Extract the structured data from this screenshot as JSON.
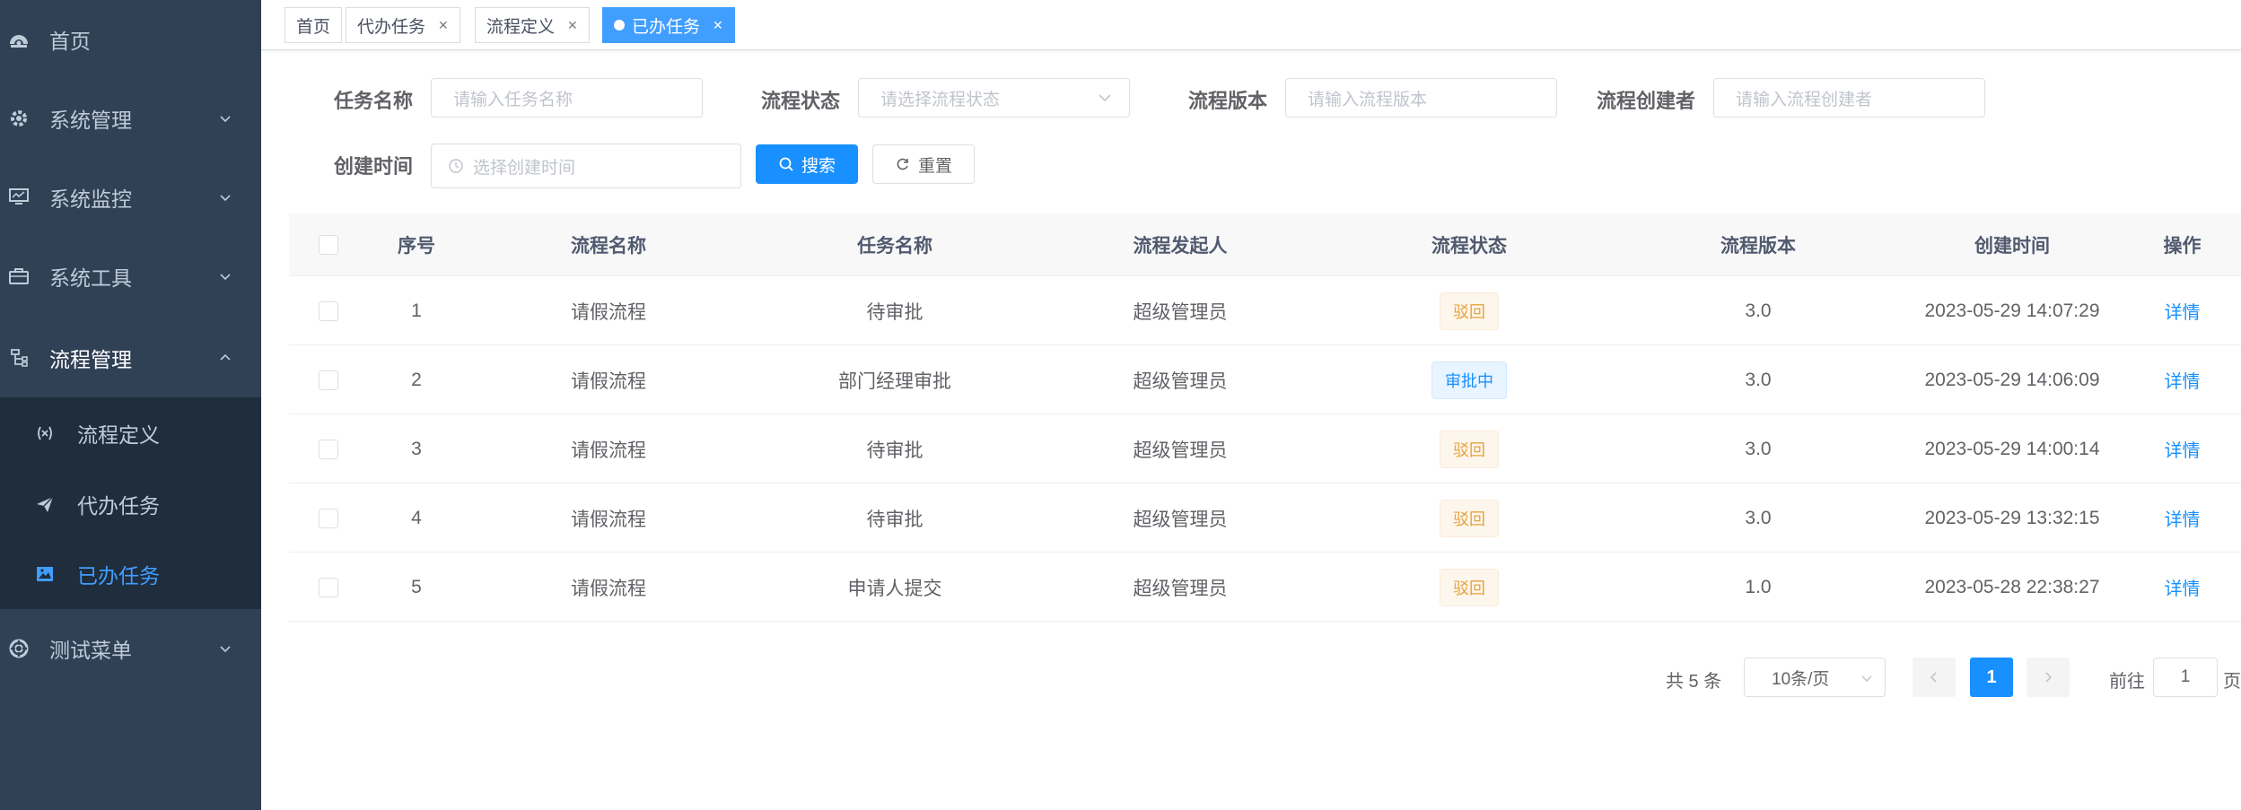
{
  "sidebar": {
    "items": [
      {
        "label": "首页",
        "icon": "dashboard-icon"
      },
      {
        "label": "系统管理",
        "icon": "gear-icon"
      },
      {
        "label": "系统监控",
        "icon": "monitor-icon"
      },
      {
        "label": "系统工具",
        "icon": "toolbox-icon"
      },
      {
        "label": "流程管理",
        "icon": "flow-icon"
      },
      {
        "label": "测试菜单",
        "icon": "test-icon"
      }
    ],
    "sub_items": [
      {
        "label": "流程定义",
        "icon": "process-definition-icon"
      },
      {
        "label": "代办任务",
        "icon": "send-icon"
      },
      {
        "label": "已办任务",
        "icon": "image-icon"
      }
    ]
  },
  "tags": [
    {
      "label": "首页"
    },
    {
      "label": "代办任务"
    },
    {
      "label": "流程定义"
    },
    {
      "label": "已办任务"
    }
  ],
  "search": {
    "task_name_label": "任务名称",
    "task_name_placeholder": "请输入任务名称",
    "status_label": "流程状态",
    "status_placeholder": "请选择流程状态",
    "version_label": "流程版本",
    "version_placeholder": "请输入流程版本",
    "creator_label": "流程创建者",
    "creator_placeholder": "请输入流程创建者",
    "time_label": "创建时间",
    "time_placeholder": "选择创建时间",
    "search_button": "搜索",
    "reset_button": "重置"
  },
  "table": {
    "columns": [
      "序号",
      "流程名称",
      "任务名称",
      "流程发起人",
      "流程状态",
      "流程版本",
      "创建时间",
      "操作"
    ],
    "rows": [
      {
        "index": "1",
        "process_name": "请假流程",
        "task_name": "待审批",
        "initiator": "超级管理员",
        "status": "驳回",
        "version": "3.0",
        "created": "2023-05-29 14:07:29",
        "action": "详情"
      },
      {
        "index": "2",
        "process_name": "请假流程",
        "task_name": "部门经理审批",
        "initiator": "超级管理员",
        "status": "审批中",
        "version": "3.0",
        "created": "2023-05-29 14:06:09",
        "action": "详情"
      },
      {
        "index": "3",
        "process_name": "请假流程",
        "task_name": "待审批",
        "initiator": "超级管理员",
        "status": "驳回",
        "version": "3.0",
        "created": "2023-05-29 14:00:14",
        "action": "详情"
      },
      {
        "index": "4",
        "process_name": "请假流程",
        "task_name": "待审批",
        "initiator": "超级管理员",
        "status": "驳回",
        "version": "3.0",
        "created": "2023-05-29 13:32:15",
        "action": "详情"
      },
      {
        "index": "5",
        "process_name": "请假流程",
        "task_name": "申请人提交",
        "initiator": "超级管理员",
        "status": "驳回",
        "version": "1.0",
        "created": "2023-05-28 22:38:27",
        "action": "详情"
      }
    ]
  },
  "pagination": {
    "total": "共 5 条",
    "page_size": "10条/页",
    "current": "1",
    "goto_prefix": "前往",
    "goto_value": "1",
    "goto_suffix": "页"
  },
  "colors": {
    "sidebar_bg": "#304156",
    "submenu_bg": "#1f2d3d",
    "accent": "#1890ff",
    "warning": "#e6a23c"
  }
}
